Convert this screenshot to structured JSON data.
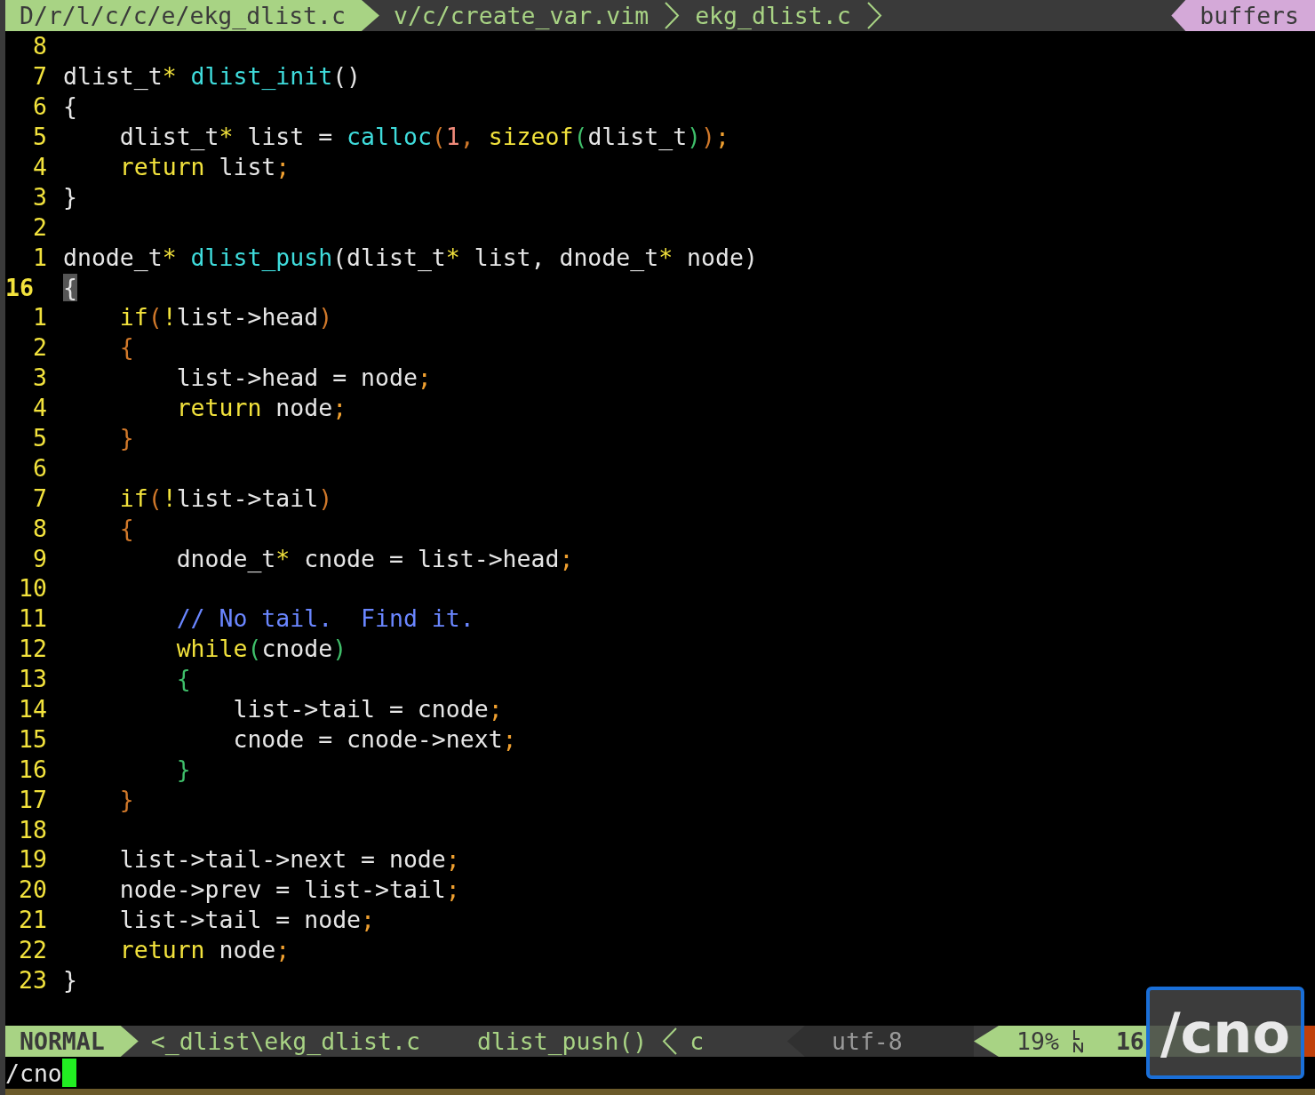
{
  "tabs": [
    {
      "label": "D/r/l/c/c/e/ekg_dlist.c",
      "selected": true
    },
    {
      "label": "v/c/create_var.vim",
      "selected": false
    },
    {
      "label": "ekg_dlist.c",
      "selected": false
    }
  ],
  "buffers_label": "buffers",
  "lines": [
    {
      "number": "8",
      "current": false
    },
    {
      "number": "7",
      "current": false,
      "tokens": [
        {
          "kind": "plain",
          "text": "dlist_t"
        },
        {
          "kind": "star",
          "text": "* "
        },
        {
          "kind": "func",
          "text": "dlist_init"
        },
        {
          "kind": "plain",
          "text": "()"
        }
      ]
    },
    {
      "number": "6",
      "current": false,
      "tokens": [
        {
          "kind": "plain",
          "text": "{"
        }
      ]
    },
    {
      "number": "5",
      "current": false,
      "tokens": [
        {
          "kind": "plain",
          "text": "    dlist_t"
        },
        {
          "kind": "star",
          "text": "*"
        },
        {
          "kind": "plain",
          "text": " list = "
        },
        {
          "kind": "func",
          "text": "calloc"
        },
        {
          "kind": "paren",
          "text": "("
        },
        {
          "kind": "number",
          "text": "1"
        },
        {
          "kind": "paren",
          "text": ", "
        },
        {
          "kind": "keyword",
          "text": "sizeof"
        },
        {
          "kind": "paren2",
          "text": "("
        },
        {
          "kind": "plain",
          "text": "dlist_t"
        },
        {
          "kind": "paren2",
          "text": ")"
        },
        {
          "kind": "paren",
          "text": ")"
        },
        {
          "kind": "punct",
          "text": ";"
        }
      ]
    },
    {
      "number": "4",
      "current": false,
      "tokens": [
        {
          "kind": "keyword",
          "text": "    return"
        },
        {
          "kind": "plain",
          "text": " list"
        },
        {
          "kind": "punct",
          "text": ";"
        }
      ]
    },
    {
      "number": "3",
      "current": false,
      "tokens": [
        {
          "kind": "plain",
          "text": "}"
        }
      ]
    },
    {
      "number": "2",
      "current": false
    },
    {
      "number": "1",
      "current": false,
      "tokens": [
        {
          "kind": "plain",
          "text": "dnode_t"
        },
        {
          "kind": "star",
          "text": "* "
        },
        {
          "kind": "func",
          "text": "dlist_push"
        },
        {
          "kind": "plain",
          "text": "(dlist_t"
        },
        {
          "kind": "star",
          "text": "*"
        },
        {
          "kind": "plain",
          "text": " list, dnode_t"
        },
        {
          "kind": "star",
          "text": "*"
        },
        {
          "kind": "plain",
          "text": " node)"
        }
      ]
    },
    {
      "number": "16",
      "current": true,
      "tokens": [
        {
          "kind": "cursor",
          "text": "{"
        }
      ]
    },
    {
      "number": "1",
      "current": false,
      "tokens": [
        {
          "kind": "keyword",
          "text": "    if"
        },
        {
          "kind": "paren",
          "text": "("
        },
        {
          "kind": "keyword",
          "text": "!"
        },
        {
          "kind": "plain",
          "text": "list->head"
        },
        {
          "kind": "paren",
          "text": ")"
        }
      ]
    },
    {
      "number": "2",
      "current": false,
      "tokens": [
        {
          "kind": "paren",
          "text": "    {"
        }
      ]
    },
    {
      "number": "3",
      "current": false,
      "tokens": [
        {
          "kind": "plain",
          "text": "        list->head = node"
        },
        {
          "kind": "punct",
          "text": ";"
        }
      ]
    },
    {
      "number": "4",
      "current": false,
      "tokens": [
        {
          "kind": "keyword",
          "text": "        return"
        },
        {
          "kind": "plain",
          "text": " node"
        },
        {
          "kind": "punct",
          "text": ";"
        }
      ]
    },
    {
      "number": "5",
      "current": false,
      "tokens": [
        {
          "kind": "paren",
          "text": "    }"
        }
      ]
    },
    {
      "number": "6",
      "current": false
    },
    {
      "number": "7",
      "current": false,
      "tokens": [
        {
          "kind": "keyword",
          "text": "    if"
        },
        {
          "kind": "paren",
          "text": "("
        },
        {
          "kind": "keyword",
          "text": "!"
        },
        {
          "kind": "plain",
          "text": "list->tail"
        },
        {
          "kind": "paren",
          "text": ")"
        }
      ]
    },
    {
      "number": "8",
      "current": false,
      "tokens": [
        {
          "kind": "paren",
          "text": "    {"
        }
      ]
    },
    {
      "number": "9",
      "current": false,
      "tokens": [
        {
          "kind": "plain",
          "text": "        dnode_t"
        },
        {
          "kind": "star",
          "text": "*"
        },
        {
          "kind": "plain",
          "text": " cnode = list->head"
        },
        {
          "kind": "punct",
          "text": ";"
        }
      ]
    },
    {
      "number": "10",
      "current": false
    },
    {
      "number": "11",
      "current": false,
      "tokens": [
        {
          "kind": "comment",
          "text": "        // No tail.  Find it."
        }
      ]
    },
    {
      "number": "12",
      "current": false,
      "tokens": [
        {
          "kind": "keyword",
          "text": "        while"
        },
        {
          "kind": "paren2",
          "text": "("
        },
        {
          "kind": "plain",
          "text": "cnode"
        },
        {
          "kind": "paren2",
          "text": ")"
        }
      ]
    },
    {
      "number": "13",
      "current": false,
      "tokens": [
        {
          "kind": "paren2",
          "text": "        {"
        }
      ]
    },
    {
      "number": "14",
      "current": false,
      "tokens": [
        {
          "kind": "plain",
          "text": "            list->tail = cnode"
        },
        {
          "kind": "punct",
          "text": ";"
        }
      ]
    },
    {
      "number": "15",
      "current": false,
      "tokens": [
        {
          "kind": "plain",
          "text": "            cnode = cnode->next"
        },
        {
          "kind": "punct",
          "text": ";"
        }
      ]
    },
    {
      "number": "16",
      "current": false,
      "tokens": [
        {
          "kind": "paren2",
          "text": "        }"
        }
      ]
    },
    {
      "number": "17",
      "current": false,
      "tokens": [
        {
          "kind": "paren",
          "text": "    }"
        }
      ]
    },
    {
      "number": "18",
      "current": false
    },
    {
      "number": "19",
      "current": false,
      "tokens": [
        {
          "kind": "plain",
          "text": "    list->tail->next = node"
        },
        {
          "kind": "punct",
          "text": ";"
        }
      ]
    },
    {
      "number": "20",
      "current": false,
      "tokens": [
        {
          "kind": "plain",
          "text": "    node->prev = list->tail"
        },
        {
          "kind": "punct",
          "text": ";"
        }
      ]
    },
    {
      "number": "21",
      "current": false,
      "tokens": [
        {
          "kind": "plain",
          "text": "    list->tail = node"
        },
        {
          "kind": "punct",
          "text": ";"
        }
      ]
    },
    {
      "number": "22",
      "current": false,
      "tokens": [
        {
          "kind": "keyword",
          "text": "    return"
        },
        {
          "kind": "plain",
          "text": " node"
        },
        {
          "kind": "punct",
          "text": ";"
        }
      ]
    },
    {
      "number": "23",
      "current": false,
      "tokens": [
        {
          "kind": "plain",
          "text": "}"
        }
      ]
    }
  ],
  "status_bar": {
    "mode": "NORMAL",
    "file": "<_dlist\\ekg_dlist.c",
    "function": "dlist_push()",
    "filetype": "c",
    "encoding": "utf-8",
    "percent": "19%",
    "line": "16"
  },
  "keystroke_overlay": "/cno",
  "command_line": "/cno"
}
